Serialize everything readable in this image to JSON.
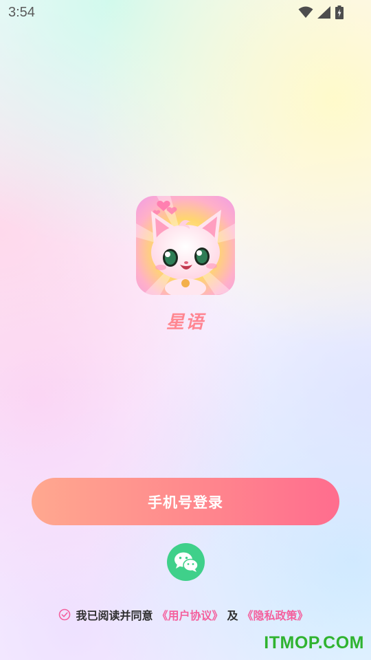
{
  "status_bar": {
    "time": "3:54",
    "icons": [
      "wifi-icon",
      "cell-signal-icon",
      "battery-charging-icon"
    ]
  },
  "app": {
    "name": "星语",
    "logo_icon": "cat-mascot-logo"
  },
  "login": {
    "phone_button_label": "手机号登录",
    "wechat_icon": "wechat-icon"
  },
  "agreement": {
    "prefix": "我已阅读并同意",
    "user_agreement": "《用户协议》",
    "conjunction": "及",
    "privacy_policy": "《隐私政策》",
    "check_icon": "check-circle-icon"
  },
  "watermark": {
    "text": "ITMOP.COM"
  },
  "colors": {
    "accent_pink": "#f4609d",
    "button_gradient_start": "#ffa88f",
    "button_gradient_end": "#ff6d8e",
    "wechat_green": "#3fd08a",
    "watermark_green": "#2fb32f"
  }
}
